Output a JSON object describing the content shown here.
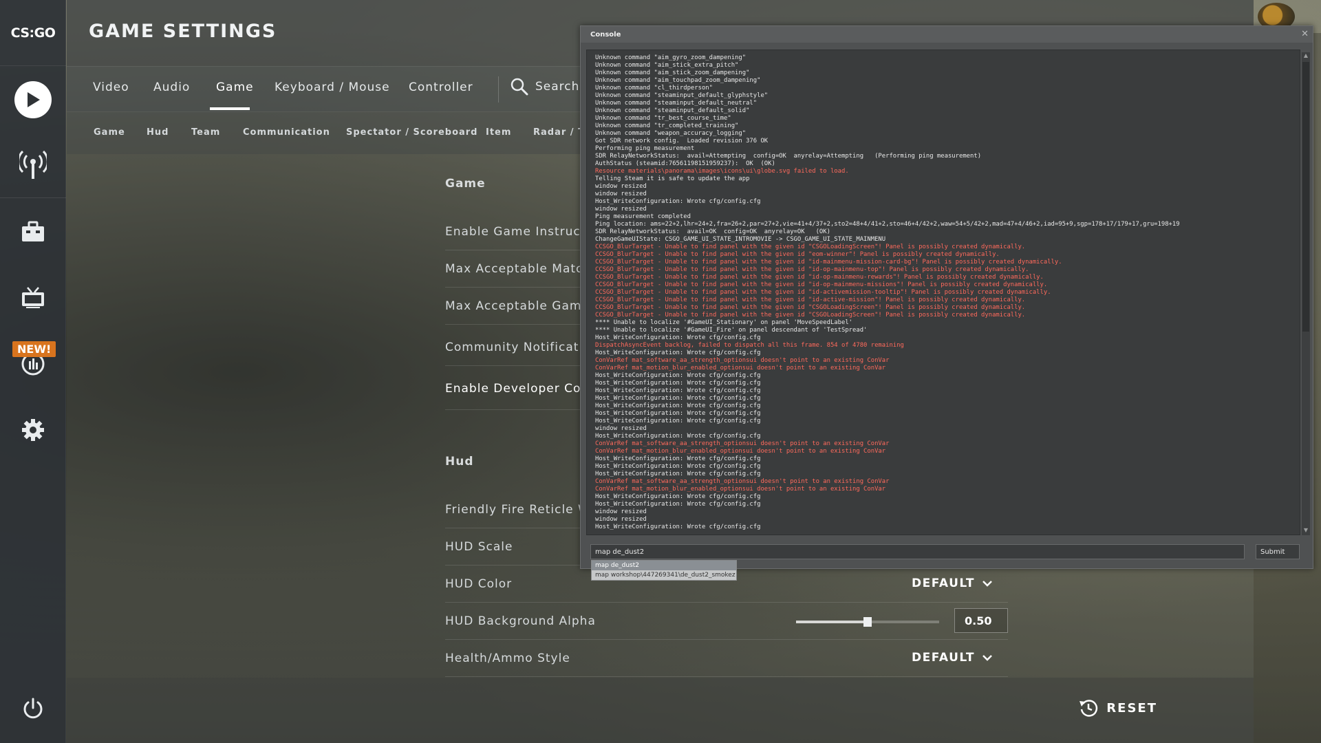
{
  "app": {
    "logo_text": "CS:GO",
    "page_title": "GAME SETTINGS",
    "new_badge": "NEW!"
  },
  "tabs": [
    {
      "label": "Video",
      "active": false
    },
    {
      "label": "Audio",
      "active": false
    },
    {
      "label": "Game",
      "active": true
    },
    {
      "label": "Keyboard / Mouse",
      "active": false
    },
    {
      "label": "Controller",
      "active": false
    }
  ],
  "search_label": "Search",
  "subtabs": [
    "Game",
    "Hud",
    "Team",
    "Communication",
    "Spectator / Scoreboard",
    "Item",
    "Radar / Ta"
  ],
  "sections": {
    "game_title": "Game",
    "hud_title": "Hud"
  },
  "game_rows": [
    "Enable Game Instructor Message",
    "Max Acceptable Matchmaking Pi",
    "Max Acceptable Game Traffic Ban",
    "Community Notification Location",
    "Enable Developer Console (~)"
  ],
  "hud_rows": {
    "friendly_fire": "Friendly Fire Reticle Warning",
    "hud_scale": "HUD Scale",
    "hud_color": "HUD Color",
    "hud_color_value": "DEFAULT",
    "hud_bg_alpha": "HUD Background Alpha",
    "hud_bg_alpha_value": "0.50",
    "hud_bg_alpha_level": 0.5,
    "health_ammo": "Health/Ammo Style",
    "health_ammo_value": "DEFAULT"
  },
  "footer": {
    "reset_label": "RESET"
  },
  "console": {
    "title": "Console",
    "input_value": "map de_dust2",
    "submit_label": "Submit",
    "suggestions": [
      "map de_dust2",
      "map workshop\\447269341\\de_dust2_smokez"
    ],
    "lines": [
      {
        "t": "Unknown command \"aim_gyro_zoom_dampening\"",
        "red": false
      },
      {
        "t": "Unknown command \"aim_stick_extra_pitch\"",
        "red": false
      },
      {
        "t": "Unknown command \"aim_stick_zoom_dampening\"",
        "red": false
      },
      {
        "t": "Unknown command \"aim_touchpad_zoom_dampening\"",
        "red": false
      },
      {
        "t": "Unknown command \"cl_thirdperson\"",
        "red": false
      },
      {
        "t": "Unknown command \"steaminput_default_glyphstyle\"",
        "red": false
      },
      {
        "t": "Unknown command \"steaminput_default_neutral\"",
        "red": false
      },
      {
        "t": "Unknown command \"steaminput_default_solid\"",
        "red": false
      },
      {
        "t": "Unknown command \"tr_best_course_time\"",
        "red": false
      },
      {
        "t": "Unknown command \"tr_completed_training\"",
        "red": false
      },
      {
        "t": "Unknown command \"weapon_accuracy_logging\"",
        "red": false
      },
      {
        "t": "Got SDR network config.  Loaded revision 376 OK",
        "red": false
      },
      {
        "t": "Performing ping measurement",
        "red": false
      },
      {
        "t": "SDR RelayNetworkStatus:  avail=Attempting  config=OK  anyrelay=Attempting   (Performing ping measurement)",
        "red": false
      },
      {
        "t": "AuthStatus (steamid:76561198151959237):  OK  (OK)",
        "red": false
      },
      {
        "t": "Resource materials\\panorama\\images\\icons\\ui\\globe.svg failed to load.",
        "red": true
      },
      {
        "t": "Telling Steam it is safe to update the app",
        "red": false
      },
      {
        "t": "window resized",
        "red": false
      },
      {
        "t": "window resized",
        "red": false
      },
      {
        "t": "Host_WriteConfiguration: Wrote cfg/config.cfg",
        "red": false
      },
      {
        "t": "window resized",
        "red": false
      },
      {
        "t": "Ping measurement completed",
        "red": false
      },
      {
        "t": "Ping location: ams=22+2,lhr=24+2,fra=26+2,par=27+2,vie=41+4/37+2,sto2=48+4/41+2,sto=46+4/42+2,waw=54+5/42+2,mad=47+4/46+2,iad=95+9,sgp=178+17/179+17,gru=198+19",
        "red": false
      },
      {
        "t": "SDR RelayNetworkStatus:  avail=OK  config=OK  anyrelay=OK   (OK)",
        "red": false
      },
      {
        "t": "ChangeGameUIState: CSGO_GAME_UI_STATE_INTROMOVIE -> CSGO_GAME_UI_STATE_MAINMENU",
        "red": false
      },
      {
        "t": "CCSGO_BlurTarget - Unable to find panel with the given id \"CSGOLoadingScreen\"! Panel is possibly created dynamically.",
        "red": true
      },
      {
        "t": "CCSGO_BlurTarget - Unable to find panel with the given id \"eom-winner\"! Panel is possibly created dynamically.",
        "red": true
      },
      {
        "t": "CCSGO_BlurTarget - Unable to find panel with the given id \"id-mainmenu-mission-card-bg\"! Panel is possibly created dynamically.",
        "red": true
      },
      {
        "t": "CCSGO_BlurTarget - Unable to find panel with the given id \"id-op-mainmenu-top\"! Panel is possibly created dynamically.",
        "red": true
      },
      {
        "t": "CCSGO_BlurTarget - Unable to find panel with the given id \"id-op-mainmenu-rewards\"! Panel is possibly created dynamically.",
        "red": true
      },
      {
        "t": "CCSGO_BlurTarget - Unable to find panel with the given id \"id-op-mainmenu-missions\"! Panel is possibly created dynamically.",
        "red": true
      },
      {
        "t": "CCSGO_BlurTarget - Unable to find panel with the given id \"id-activemission-tooltip\"! Panel is possibly created dynamically.",
        "red": true
      },
      {
        "t": "CCSGO_BlurTarget - Unable to find panel with the given id \"id-active-mission\"! Panel is possibly created dynamically.",
        "red": true
      },
      {
        "t": "CCSGO_BlurTarget - Unable to find panel with the given id \"CSGOLoadingScreen\"! Panel is possibly created dynamically.",
        "red": true
      },
      {
        "t": "CCSGO_BlurTarget - Unable to find panel with the given id \"CSGOLoadingScreen\"! Panel is possibly created dynamically.",
        "red": true
      },
      {
        "t": "**** Unable to localize '#GameUI_Stationary' on panel 'MoveSpeedLabel'",
        "red": false
      },
      {
        "t": "**** Unable to localize '#GameUI_Fire' on panel descendant of 'TestSpread'",
        "red": false
      },
      {
        "t": "Host_WriteConfiguration: Wrote cfg/config.cfg",
        "red": false
      },
      {
        "t": "DispatchAsyncEvent backlog, failed to dispatch all this frame. 854 of 4780 remaining",
        "red": true
      },
      {
        "t": "Host_WriteConfiguration: Wrote cfg/config.cfg",
        "red": false
      },
      {
        "t": "ConVarRef mat_software_aa_strength_optionsui doesn't point to an existing ConVar",
        "red": true
      },
      {
        "t": "ConVarRef mat_motion_blur_enabled_optionsui doesn't point to an existing ConVar",
        "red": true
      },
      {
        "t": "Host_WriteConfiguration: Wrote cfg/config.cfg",
        "red": false
      },
      {
        "t": "Host_WriteConfiguration: Wrote cfg/config.cfg",
        "red": false
      },
      {
        "t": "Host_WriteConfiguration: Wrote cfg/config.cfg",
        "red": false
      },
      {
        "t": "Host_WriteConfiguration: Wrote cfg/config.cfg",
        "red": false
      },
      {
        "t": "Host_WriteConfiguration: Wrote cfg/config.cfg",
        "red": false
      },
      {
        "t": "Host_WriteConfiguration: Wrote cfg/config.cfg",
        "red": false
      },
      {
        "t": "Host_WriteConfiguration: Wrote cfg/config.cfg",
        "red": false
      },
      {
        "t": "window resized",
        "red": false
      },
      {
        "t": "Host_WriteConfiguration: Wrote cfg/config.cfg",
        "red": false
      },
      {
        "t": "ConVarRef mat_software_aa_strength_optionsui doesn't point to an existing ConVar",
        "red": true
      },
      {
        "t": "ConVarRef mat_motion_blur_enabled_optionsui doesn't point to an existing ConVar",
        "red": true
      },
      {
        "t": "Host_WriteConfiguration: Wrote cfg/config.cfg",
        "red": false
      },
      {
        "t": "Host_WriteConfiguration: Wrote cfg/config.cfg",
        "red": false
      },
      {
        "t": "Host_WriteConfiguration: Wrote cfg/config.cfg",
        "red": false
      },
      {
        "t": "ConVarRef mat_software_aa_strength_optionsui doesn't point to an existing ConVar",
        "red": true
      },
      {
        "t": "ConVarRef mat_motion_blur_enabled_optionsui doesn't point to an existing ConVar",
        "red": true
      },
      {
        "t": "Host_WriteConfiguration: Wrote cfg/config.cfg",
        "red": false
      },
      {
        "t": "Host_WriteConfiguration: Wrote cfg/config.cfg",
        "red": false
      },
      {
        "t": "window resized",
        "red": false
      },
      {
        "t": "window resized",
        "red": false
      },
      {
        "t": "Host_WriteConfiguration: Wrote cfg/config.cfg",
        "red": false
      }
    ]
  },
  "colors": {
    "accent_orange": "#d8741e",
    "console_error": "#ff6a5c"
  }
}
